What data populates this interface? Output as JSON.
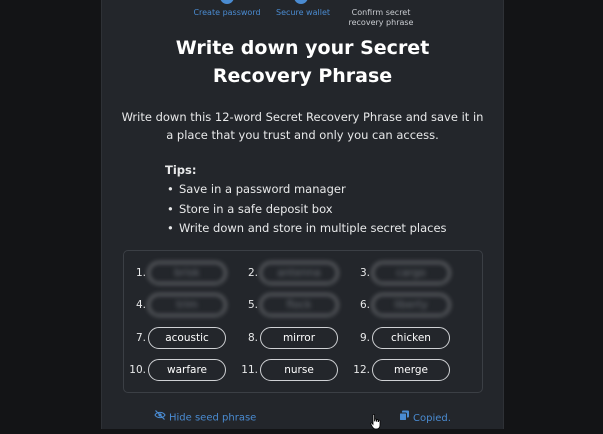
{
  "steps": [
    {
      "label": "Create password",
      "state": "done"
    },
    {
      "label": "Secure wallet",
      "state": "done"
    },
    {
      "label": "Confirm secret recovery phrase",
      "state": "current"
    }
  ],
  "title_line1": "Write down your Secret",
  "title_line2": "Recovery Phrase",
  "intro": "Write down this 12-word Secret Recovery Phrase and save it in a place that you trust and only you can access.",
  "tips": {
    "title": "Tips:",
    "items": [
      "Save in a password manager",
      "Store in a safe deposit box",
      "Write down and store in multiple secret places"
    ]
  },
  "words": [
    {
      "num": "1.",
      "word": "brisk",
      "hidden": true
    },
    {
      "num": "2.",
      "word": "antenna",
      "hidden": true
    },
    {
      "num": "3.",
      "word": "cargo",
      "hidden": true
    },
    {
      "num": "4.",
      "word": "trim",
      "hidden": true
    },
    {
      "num": "5.",
      "word": "flock",
      "hidden": true
    },
    {
      "num": "6.",
      "word": "liberty",
      "hidden": true
    },
    {
      "num": "7.",
      "word": "acoustic",
      "hidden": false
    },
    {
      "num": "8.",
      "word": "mirror",
      "hidden": false
    },
    {
      "num": "9.",
      "word": "chicken",
      "hidden": false
    },
    {
      "num": "10.",
      "word": "warfare",
      "hidden": false
    },
    {
      "num": "11.",
      "word": "nurse",
      "hidden": false
    },
    {
      "num": "12.",
      "word": "merge",
      "hidden": false
    }
  ],
  "hide_seed_label": "Hide seed phrase",
  "copied_label": "Copied.",
  "colors": {
    "accent": "#4a8bd1",
    "panel": "#23262b",
    "background": "#131416"
  },
  "icons": {
    "hide": "eye-slash-icon",
    "copy": "copy-icon",
    "cursor": "hand-cursor-icon"
  }
}
